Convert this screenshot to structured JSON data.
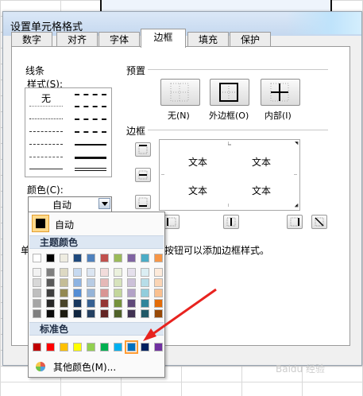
{
  "dialog": {
    "title": "设置单元格格式"
  },
  "tabs": [
    {
      "label": "数字"
    },
    {
      "label": "对齐"
    },
    {
      "label": "字体"
    },
    {
      "label": "边框"
    },
    {
      "label": "填充"
    },
    {
      "label": "保护"
    }
  ],
  "active_tab": "边框",
  "line": {
    "group_label": "线条",
    "style_label": "样式(S):",
    "none_label": "无",
    "color_label": "颜色(C):",
    "color_value": "自动"
  },
  "presets": {
    "label": "预置",
    "items": [
      {
        "label": "无(N)"
      },
      {
        "label": "外边框(O)"
      },
      {
        "label": "内部(I)"
      }
    ]
  },
  "border": {
    "label": "边框",
    "preview_texts": [
      "文本",
      "文本",
      "文本",
      "文本"
    ]
  },
  "hint": {
    "prefix": "单",
    "suffix": "按钮可以添加边框样式。"
  },
  "color_popup": {
    "auto_label": "自动",
    "theme_label": "主题颜色",
    "theme_top": [
      "#ffffff",
      "#000000",
      "#eeece1",
      "#1f497d",
      "#4f81bd",
      "#c0504d",
      "#9bbb59",
      "#8064a2",
      "#4bacc6",
      "#f79646"
    ],
    "theme_shades": [
      [
        "#f2f2f2",
        "#d8d8d8",
        "#bfbfbf",
        "#a5a5a5",
        "#7f7f7f"
      ],
      [
        "#7f7f7f",
        "#595959",
        "#3f3f3f",
        "#262626",
        "#0c0c0c"
      ],
      [
        "#ddd9c3",
        "#c4bd97",
        "#938953",
        "#494429",
        "#1d1b10"
      ],
      [
        "#c6d9f0",
        "#8db3e2",
        "#548dd4",
        "#17365d",
        "#0f243e"
      ],
      [
        "#dbe5f1",
        "#b8cce4",
        "#95b3d7",
        "#366092",
        "#244061"
      ],
      [
        "#f2dcdb",
        "#e5b9b7",
        "#d99694",
        "#953734",
        "#632423"
      ],
      [
        "#ebf1dd",
        "#d7e3bc",
        "#c3d69b",
        "#76923c",
        "#4f6128"
      ],
      [
        "#e5e0ec",
        "#ccc1d9",
        "#b2a2c7",
        "#5f497a",
        "#3f3151"
      ],
      [
        "#dbeef3",
        "#b7dde8",
        "#92cddc",
        "#31859b",
        "#205867"
      ],
      [
        "#fdeada",
        "#fbd5b5",
        "#fac08f",
        "#e36c09",
        "#974806"
      ]
    ],
    "standard_label": "标准色",
    "standard": [
      "#c00000",
      "#ff0000",
      "#ffc000",
      "#ffff00",
      "#92d050",
      "#00b050",
      "#00b0f0",
      "#0070c0",
      "#002060",
      "#7030a0"
    ],
    "selected_standard_index": 7,
    "more_label": "其他颜色(M)..."
  },
  "accent_colors": {
    "dropdown_header": "#dde7f3",
    "selection": "#ff9c33",
    "annotation_arrow": "#e8231f"
  },
  "watermark": "Baidu 经验"
}
